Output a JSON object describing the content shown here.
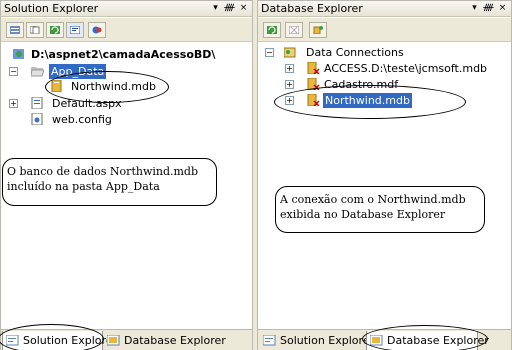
{
  "solution_explorer": {
    "title": "Solution Explorer",
    "ctrl_dropdown": "▾",
    "ctrl_pin": "ᚎ",
    "ctrl_close": "×",
    "tree": {
      "root": "D:\\aspnet2\\camadaAcessoBD\\",
      "folder": "App_Data",
      "db_file": "Northwind.mdb",
      "default_page": "Default.aspx",
      "web_config": "web.config"
    },
    "callout": "O banco de dados Northwind.mdb incluído na pasta App_Data",
    "tab_solution": "Solution Explorer",
    "tab_database": "Database Explorer"
  },
  "database_explorer": {
    "title": "Database Explorer",
    "ctrl_dropdown": "▾",
    "ctrl_pin": "ᚎ",
    "ctrl_close": "×",
    "tree": {
      "root": "Data Connections",
      "conn1": "ACCESS.D:\\teste\\jcmsoft.mdb",
      "conn2": "Cadastro.mdf",
      "conn3": "Northwind.mdb"
    },
    "callout": "A conexão com o Northwind.mdb exibida no Database Explorer",
    "tab_solution": "Solution Explorer",
    "tab_database": "Database Explorer"
  },
  "colors": {
    "selection": "#316ac5",
    "panel_chrome": "#ece9d8",
    "db_icon": "#e8b83a"
  }
}
